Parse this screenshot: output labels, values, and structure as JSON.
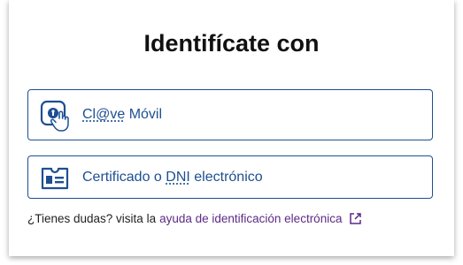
{
  "title": "Identifícate con",
  "options": [
    {
      "prefix": "Cl@ve",
      "suffix": " Móvil",
      "icon": "clave-hand-icon"
    },
    {
      "prefix": "Certificado o ",
      "abbr": "DNI",
      "suffix": " electrónico",
      "icon": "id-card-icon"
    }
  ],
  "help": {
    "text": "¿Tienes dudas? visita la",
    "link": "ayuda de identificación electrónica",
    "icon": "external-link-icon"
  },
  "colors": {
    "primary": "#1d4f91",
    "link": "#5b2a86",
    "title": "#111111"
  }
}
